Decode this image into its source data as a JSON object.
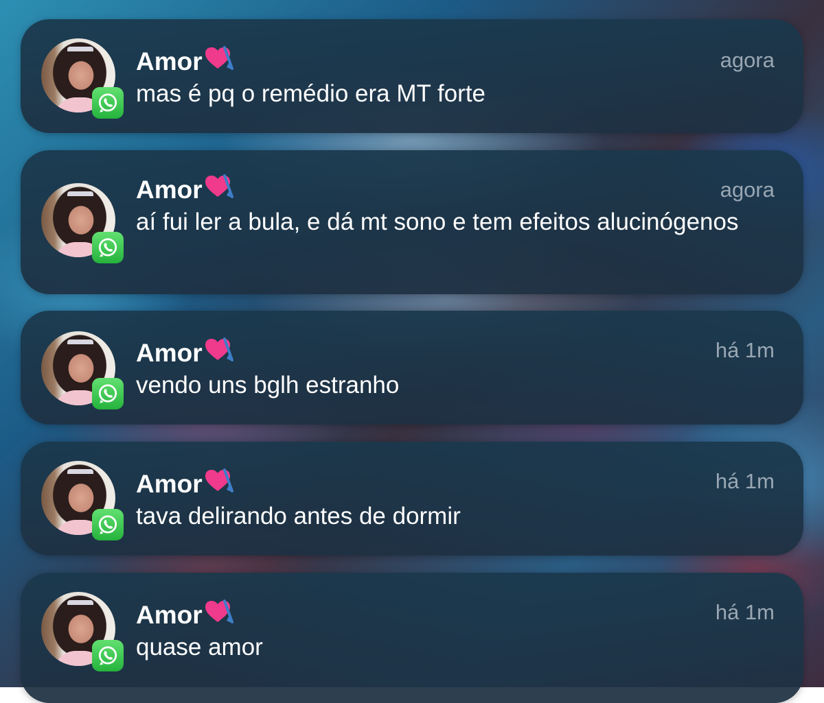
{
  "colors": {
    "whatsapp_green": "#25b33c",
    "notification_bg": "#1e3a4e",
    "heart_pink": "#f03a8c",
    "arrow_blue": "#3e7ec8"
  },
  "icons": {
    "app": "whatsapp-icon",
    "sender_emoji": "heart-with-arrow-icon"
  },
  "notifications": [
    {
      "sender": "Amor",
      "time": "agora",
      "message": "mas é pq o remédio era MT forte"
    },
    {
      "sender": "Amor",
      "time": "agora",
      "message": "aí fui ler a bula, e dá mt sono e tem efeitos alucinógenos"
    },
    {
      "sender": "Amor",
      "time": "há 1m",
      "message": "vendo uns bglh estranho"
    },
    {
      "sender": "Amor",
      "time": "há 1m",
      "message": "tava delirando antes de dormir"
    },
    {
      "sender": "Amor",
      "time": "há 1m",
      "message": "quase amor"
    }
  ]
}
